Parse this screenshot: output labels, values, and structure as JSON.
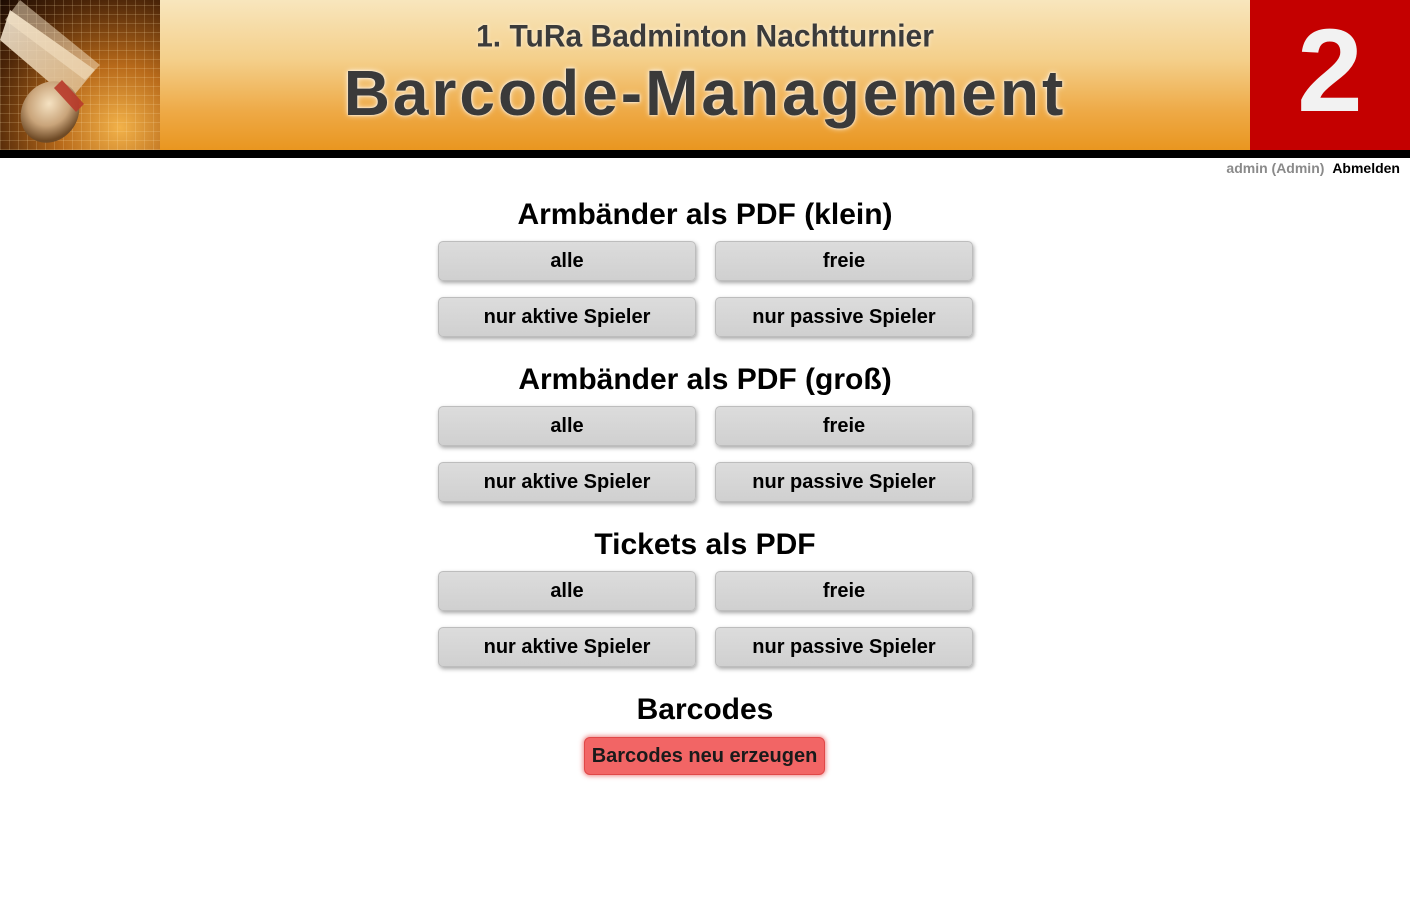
{
  "header": {
    "subtitle": "1. TuRa Badminton Nachtturnier",
    "title": "Barcode-Management",
    "badge": "2"
  },
  "userbar": {
    "user": "admin (Admin)",
    "logout_label": "Abmelden"
  },
  "sections": [
    {
      "title": "Armbänder als PDF (klein)",
      "buttons": [
        "alle",
        "freie",
        "nur aktive Spieler",
        "nur passive Spieler"
      ]
    },
    {
      "title": "Armbänder als PDF (groß)",
      "buttons": [
        "alle",
        "freie",
        "nur aktive Spieler",
        "nur passive Spieler"
      ]
    },
    {
      "title": "Tickets als PDF",
      "buttons": [
        "alle",
        "freie",
        "nur aktive Spieler",
        "nur passive Spieler"
      ]
    }
  ],
  "barcodes": {
    "title": "Barcodes",
    "regenerate_label": "Barcodes neu erzeugen"
  },
  "colors": {
    "badge_background": "#c40000",
    "header_gradient_top": "#f8e6bd",
    "header_gradient_bottom": "#e99620",
    "danger_button": "#f26565"
  }
}
